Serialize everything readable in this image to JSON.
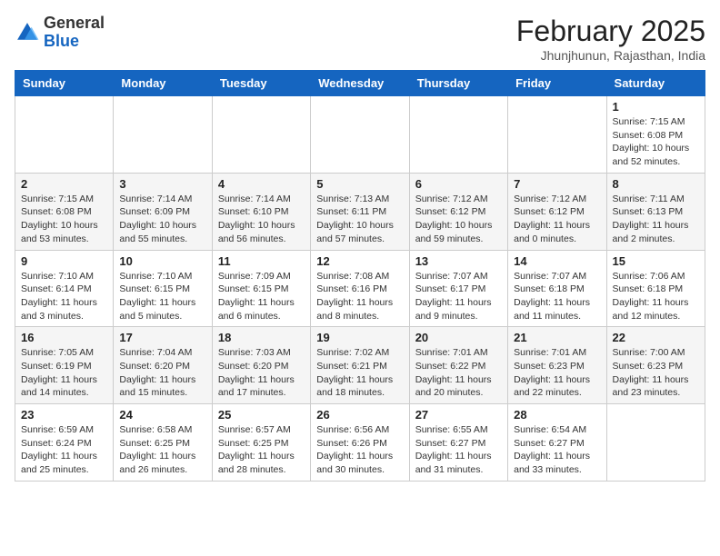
{
  "header": {
    "logo_general": "General",
    "logo_blue": "Blue",
    "month": "February 2025",
    "location": "Jhunjhunun, Rajasthan, India"
  },
  "days_of_week": [
    "Sunday",
    "Monday",
    "Tuesday",
    "Wednesday",
    "Thursday",
    "Friday",
    "Saturday"
  ],
  "weeks": [
    [
      {
        "day": "",
        "info": ""
      },
      {
        "day": "",
        "info": ""
      },
      {
        "day": "",
        "info": ""
      },
      {
        "day": "",
        "info": ""
      },
      {
        "day": "",
        "info": ""
      },
      {
        "day": "",
        "info": ""
      },
      {
        "day": "1",
        "info": "Sunrise: 7:15 AM\nSunset: 6:08 PM\nDaylight: 10 hours\nand 52 minutes."
      }
    ],
    [
      {
        "day": "2",
        "info": "Sunrise: 7:15 AM\nSunset: 6:08 PM\nDaylight: 10 hours\nand 53 minutes."
      },
      {
        "day": "3",
        "info": "Sunrise: 7:14 AM\nSunset: 6:09 PM\nDaylight: 10 hours\nand 55 minutes."
      },
      {
        "day": "4",
        "info": "Sunrise: 7:14 AM\nSunset: 6:10 PM\nDaylight: 10 hours\nand 56 minutes."
      },
      {
        "day": "5",
        "info": "Sunrise: 7:13 AM\nSunset: 6:11 PM\nDaylight: 10 hours\nand 57 minutes."
      },
      {
        "day": "6",
        "info": "Sunrise: 7:12 AM\nSunset: 6:12 PM\nDaylight: 10 hours\nand 59 minutes."
      },
      {
        "day": "7",
        "info": "Sunrise: 7:12 AM\nSunset: 6:12 PM\nDaylight: 11 hours\nand 0 minutes."
      },
      {
        "day": "8",
        "info": "Sunrise: 7:11 AM\nSunset: 6:13 PM\nDaylight: 11 hours\nand 2 minutes."
      }
    ],
    [
      {
        "day": "9",
        "info": "Sunrise: 7:10 AM\nSunset: 6:14 PM\nDaylight: 11 hours\nand 3 minutes."
      },
      {
        "day": "10",
        "info": "Sunrise: 7:10 AM\nSunset: 6:15 PM\nDaylight: 11 hours\nand 5 minutes."
      },
      {
        "day": "11",
        "info": "Sunrise: 7:09 AM\nSunset: 6:15 PM\nDaylight: 11 hours\nand 6 minutes."
      },
      {
        "day": "12",
        "info": "Sunrise: 7:08 AM\nSunset: 6:16 PM\nDaylight: 11 hours\nand 8 minutes."
      },
      {
        "day": "13",
        "info": "Sunrise: 7:07 AM\nSunset: 6:17 PM\nDaylight: 11 hours\nand 9 minutes."
      },
      {
        "day": "14",
        "info": "Sunrise: 7:07 AM\nSunset: 6:18 PM\nDaylight: 11 hours\nand 11 minutes."
      },
      {
        "day": "15",
        "info": "Sunrise: 7:06 AM\nSunset: 6:18 PM\nDaylight: 11 hours\nand 12 minutes."
      }
    ],
    [
      {
        "day": "16",
        "info": "Sunrise: 7:05 AM\nSunset: 6:19 PM\nDaylight: 11 hours\nand 14 minutes."
      },
      {
        "day": "17",
        "info": "Sunrise: 7:04 AM\nSunset: 6:20 PM\nDaylight: 11 hours\nand 15 minutes."
      },
      {
        "day": "18",
        "info": "Sunrise: 7:03 AM\nSunset: 6:20 PM\nDaylight: 11 hours\nand 17 minutes."
      },
      {
        "day": "19",
        "info": "Sunrise: 7:02 AM\nSunset: 6:21 PM\nDaylight: 11 hours\nand 18 minutes."
      },
      {
        "day": "20",
        "info": "Sunrise: 7:01 AM\nSunset: 6:22 PM\nDaylight: 11 hours\nand 20 minutes."
      },
      {
        "day": "21",
        "info": "Sunrise: 7:01 AM\nSunset: 6:23 PM\nDaylight: 11 hours\nand 22 minutes."
      },
      {
        "day": "22",
        "info": "Sunrise: 7:00 AM\nSunset: 6:23 PM\nDaylight: 11 hours\nand 23 minutes."
      }
    ],
    [
      {
        "day": "23",
        "info": "Sunrise: 6:59 AM\nSunset: 6:24 PM\nDaylight: 11 hours\nand 25 minutes."
      },
      {
        "day": "24",
        "info": "Sunrise: 6:58 AM\nSunset: 6:25 PM\nDaylight: 11 hours\nand 26 minutes."
      },
      {
        "day": "25",
        "info": "Sunrise: 6:57 AM\nSunset: 6:25 PM\nDaylight: 11 hours\nand 28 minutes."
      },
      {
        "day": "26",
        "info": "Sunrise: 6:56 AM\nSunset: 6:26 PM\nDaylight: 11 hours\nand 30 minutes."
      },
      {
        "day": "27",
        "info": "Sunrise: 6:55 AM\nSunset: 6:27 PM\nDaylight: 11 hours\nand 31 minutes."
      },
      {
        "day": "28",
        "info": "Sunrise: 6:54 AM\nSunset: 6:27 PM\nDaylight: 11 hours\nand 33 minutes."
      },
      {
        "day": "",
        "info": ""
      }
    ]
  ]
}
